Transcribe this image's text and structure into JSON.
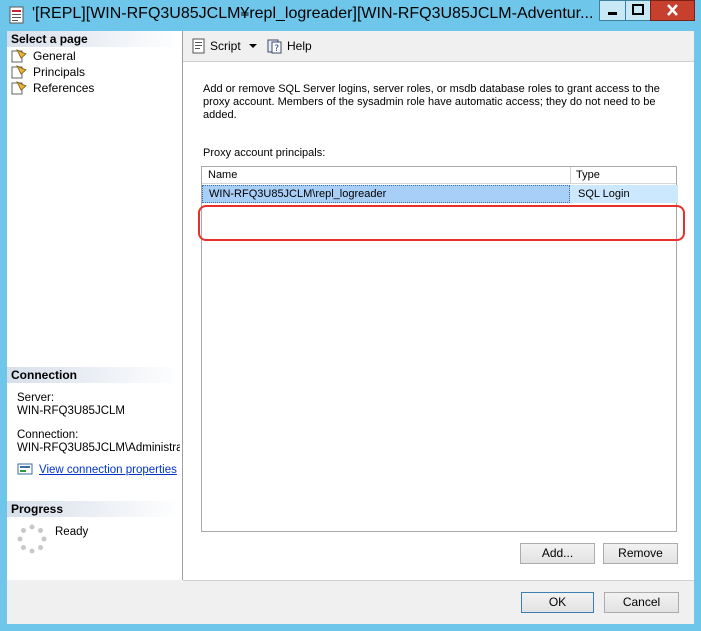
{
  "window": {
    "title": "'[REPL][WIN-RFQ3U85JCLM¥repl_logreader][WIN-RFQ3U85JCLM-Adventur...",
    "accent": "#6ec6ea"
  },
  "sidebar": {
    "select_header": "Select a page",
    "pages": [
      {
        "label": "General",
        "icon": "page-icon"
      },
      {
        "label": "Principals",
        "icon": "page-icon"
      },
      {
        "label": "References",
        "icon": "page-icon"
      }
    ],
    "connection_header": "Connection",
    "server_label": "Server:",
    "server_value": "WIN-RFQ3U85JCLM",
    "connection_label": "Connection:",
    "connection_value": "WIN-RFQ3U85JCLM\\Administratc",
    "view_props_link": "View connection properties",
    "progress_header": "Progress",
    "progress_status": "Ready"
  },
  "toolbar": {
    "script_label": "Script",
    "help_label": "Help"
  },
  "main": {
    "description": "Add or remove SQL Server logins, server roles, or msdb database roles to grant access to the proxy account. Members of the sysadmin role have automatic access; they do not need to be added.",
    "principals_label": "Proxy account principals:",
    "columns": [
      "Name",
      "Type"
    ],
    "rows": [
      {
        "name": "WIN-RFQ3U85JCLM\\repl_logreader",
        "type": "SQL Login"
      }
    ],
    "add_label": "Add...",
    "remove_label": "Remove"
  },
  "footer": {
    "ok_label": "OK",
    "cancel_label": "Cancel"
  }
}
